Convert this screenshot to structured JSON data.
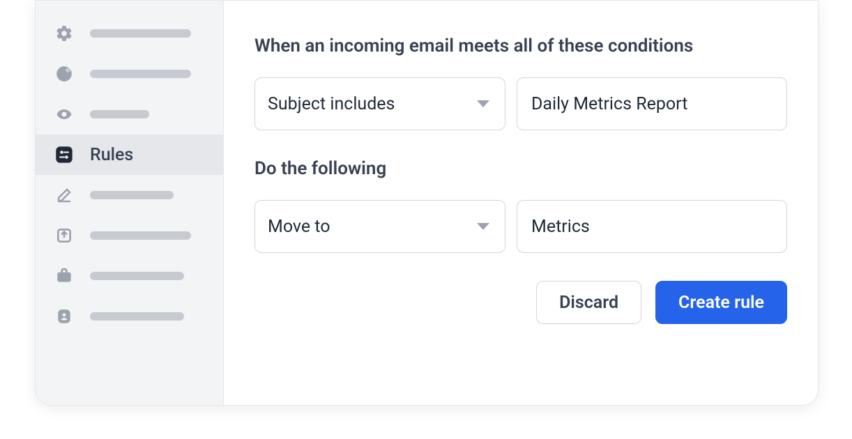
{
  "sidebar": {
    "items": [
      {
        "icon": "gear-icon"
      },
      {
        "icon": "pie-chart-icon"
      },
      {
        "icon": "eye-icon"
      },
      {
        "icon": "sliders-icon",
        "label": "Rules",
        "active": true
      },
      {
        "icon": "pencil-icon"
      },
      {
        "icon": "share-icon"
      },
      {
        "icon": "briefcase-icon"
      },
      {
        "icon": "contact-icon"
      }
    ]
  },
  "form": {
    "conditions_title": "When an incoming email meets all of these conditions",
    "condition_type": "Subject includes",
    "condition_value": "Daily Metrics Report",
    "actions_title": "Do the following",
    "action_type": "Move to",
    "action_value": "Metrics"
  },
  "buttons": {
    "discard": "Discard",
    "create": "Create rule"
  }
}
